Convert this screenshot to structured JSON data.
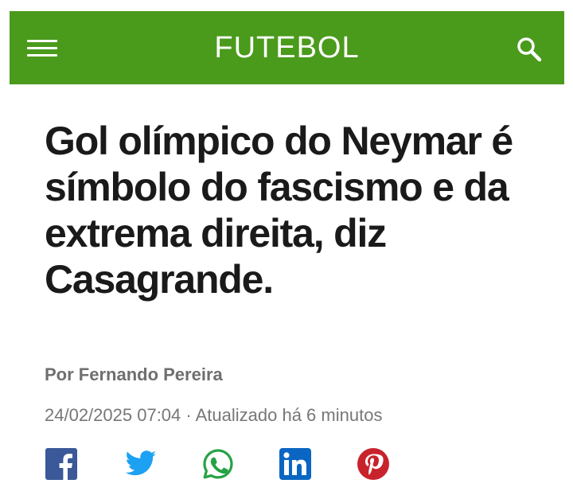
{
  "header": {
    "title": "FUTEBOL",
    "background_color": "#4a9a1c",
    "menu_icon": "hamburger-menu-icon",
    "search_icon": "search-icon"
  },
  "article": {
    "headline": "Gol olímpico do Neymar é símbolo do fascismo e da extrema direita, diz Casagrande.",
    "author": "Por Fernando Pereira",
    "date": "24/02/2025 07:04",
    "separator": " · ",
    "updated": "Atualizado há 6 minutos"
  },
  "share": [
    {
      "name": "facebook",
      "icon": "facebook-icon",
      "color": "#3b5998"
    },
    {
      "name": "twitter",
      "icon": "twitter-icon",
      "color": "#1da1f2"
    },
    {
      "name": "whatsapp",
      "icon": "whatsapp-icon",
      "color": "#25a244"
    },
    {
      "name": "linkedin",
      "icon": "linkedin-icon",
      "color": "#0a66c2"
    },
    {
      "name": "pinterest",
      "icon": "pinterest-icon",
      "color": "#c8232c"
    }
  ]
}
